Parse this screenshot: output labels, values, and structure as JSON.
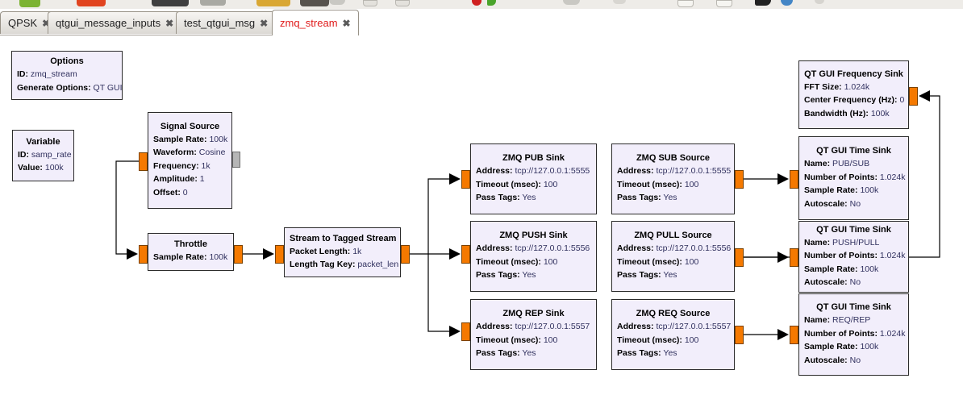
{
  "colors": {
    "block_fill": "#f2eefb",
    "block_border": "#2b2b2b",
    "port_orange": "#f57900",
    "port_gray": "#b6b6b6",
    "active_tab_text": "#e01b1b",
    "connection": "#000000",
    "port_icon_orange": "#f57900"
  },
  "toolbar": {
    "icons": [
      {
        "name": "new-flowgraph-icon",
        "color": "#7cb332"
      },
      {
        "name": "open-flowgraph-icon",
        "color": "#e1441f"
      },
      {
        "name": "save-flowgraph-icon",
        "color": "#3f3f3f"
      },
      {
        "name": "close-flowgraph-icon",
        "color": "#a9a9a3"
      },
      {
        "name": "edit-icon",
        "color": "#d9a733"
      },
      {
        "name": "print-icon",
        "color": "#57534e"
      },
      {
        "name": "cut-icon",
        "color": "#c9c8c3"
      },
      {
        "name": "copy-icon",
        "color": "#e3e1dc"
      },
      {
        "name": "paste-icon",
        "color": "#e3e1dc"
      },
      {
        "name": "error-check-icon",
        "color": "#cf2020"
      },
      {
        "name": "run-icon",
        "color": "#4aa42c"
      },
      {
        "name": "undo-icon",
        "color": "#c9c8c3"
      },
      {
        "name": "redo-icon",
        "color": "#d8d6d1"
      },
      {
        "name": "zoom-in-icon",
        "color": "#f6f5f1"
      },
      {
        "name": "zoom-out-icon",
        "color": "#f6f5f1"
      },
      {
        "name": "search-icon",
        "color": "#222222"
      },
      {
        "name": "help-icon",
        "color": "#4486c6"
      },
      {
        "name": "options-icon",
        "color": "#d6d4cf"
      }
    ]
  },
  "tab_close_glyph": "✖",
  "tabs": [
    {
      "label": "QPSK"
    },
    {
      "label": "qtgui_message_inputs"
    },
    {
      "label": "test_qtgui_msg"
    },
    {
      "label": "zmq_stream",
      "active": true
    }
  ],
  "blocks": {
    "options": {
      "title": "Options",
      "params": [
        {
          "label": "ID:",
          "value": "zmq_stream"
        },
        {
          "label": "Generate Options:",
          "value": "QT GUI"
        }
      ]
    },
    "variable": {
      "title": "Variable",
      "params": [
        {
          "label": "ID:",
          "value": "samp_rate"
        },
        {
          "label": "Value:",
          "value": "100k"
        }
      ]
    },
    "signal_source": {
      "title": "Signal Source",
      "params": [
        {
          "label": "Sample Rate:",
          "value": "100k"
        },
        {
          "label": "Waveform:",
          "value": "Cosine"
        },
        {
          "label": "Frequency:",
          "value": "1k"
        },
        {
          "label": "Amplitude:",
          "value": "1"
        },
        {
          "label": "Offset:",
          "value": "0"
        }
      ]
    },
    "throttle": {
      "title": "Throttle",
      "params": [
        {
          "label": "Sample Rate:",
          "value": "100k"
        }
      ]
    },
    "stream_to_tagged_stream": {
      "title": "Stream to Tagged Stream",
      "params": [
        {
          "label": "Packet Length:",
          "value": "1k"
        },
        {
          "label": "Length Tag Key:",
          "value": "packet_len"
        }
      ]
    },
    "zmq_pub_sink": {
      "title": "ZMQ PUB Sink",
      "params": [
        {
          "label": "Address:",
          "value": "tcp://127.0.0.1:5555"
        },
        {
          "label": "Timeout (msec):",
          "value": "100"
        },
        {
          "label": "Pass Tags:",
          "value": "Yes"
        }
      ]
    },
    "zmq_push_sink": {
      "title": "ZMQ PUSH Sink",
      "params": [
        {
          "label": "Address:",
          "value": "tcp://127.0.0.1:5556"
        },
        {
          "label": "Timeout (msec):",
          "value": "100"
        },
        {
          "label": "Pass Tags:",
          "value": "Yes"
        }
      ]
    },
    "zmq_rep_sink": {
      "title": "ZMQ REP Sink",
      "params": [
        {
          "label": "Address:",
          "value": "tcp://127.0.0.1:5557"
        },
        {
          "label": "Timeout (msec):",
          "value": "100"
        },
        {
          "label": "Pass Tags:",
          "value": "Yes"
        }
      ]
    },
    "zmq_sub_source": {
      "title": "ZMQ SUB Source",
      "params": [
        {
          "label": "Address:",
          "value": "tcp://127.0.0.1:5555"
        },
        {
          "label": "Timeout (msec):",
          "value": "100"
        },
        {
          "label": "Pass Tags:",
          "value": "Yes"
        }
      ]
    },
    "zmq_pull_source": {
      "title": "ZMQ PULL Source",
      "params": [
        {
          "label": "Address:",
          "value": "tcp://127.0.0.1:5556"
        },
        {
          "label": "Timeout (msec):",
          "value": "100"
        },
        {
          "label": "Pass Tags:",
          "value": "Yes"
        }
      ]
    },
    "zmq_req_source": {
      "title": "ZMQ REQ Source",
      "params": [
        {
          "label": "Address:",
          "value": "tcp://127.0.0.1:5557"
        },
        {
          "label": "Timeout (msec):",
          "value": "100"
        },
        {
          "label": "Pass Tags:",
          "value": "Yes"
        }
      ]
    },
    "qt_gui_freq_sink": {
      "title": "QT GUI Frequency Sink",
      "params": [
        {
          "label": "FFT Size:",
          "value": "1.024k"
        },
        {
          "label": "Center Frequency (Hz):",
          "value": "0"
        },
        {
          "label": "Bandwidth (Hz):",
          "value": "100k"
        }
      ]
    },
    "qt_gui_time_sink_pub": {
      "title": "QT GUI Time Sink",
      "params": [
        {
          "label": "Name:",
          "value": "PUB/SUB"
        },
        {
          "label": "Number of Points:",
          "value": "1.024k"
        },
        {
          "label": "Sample Rate:",
          "value": "100k"
        },
        {
          "label": "Autoscale:",
          "value": "No"
        }
      ]
    },
    "qt_gui_time_sink_push": {
      "title": "QT GUI Time Sink",
      "params": [
        {
          "label": "Name:",
          "value": "PUSH/PULL"
        },
        {
          "label": "Number of Points:",
          "value": "1.024k"
        },
        {
          "label": "Sample Rate:",
          "value": "100k"
        },
        {
          "label": "Autoscale:",
          "value": "No"
        }
      ]
    },
    "qt_gui_time_sink_req": {
      "title": "QT GUI Time Sink",
      "params": [
        {
          "label": "Name:",
          "value": "REQ/REP"
        },
        {
          "label": "Number of Points:",
          "value": "1.024k"
        },
        {
          "label": "Sample Rate:",
          "value": "100k"
        },
        {
          "label": "Autoscale:",
          "value": "No"
        }
      ]
    }
  }
}
